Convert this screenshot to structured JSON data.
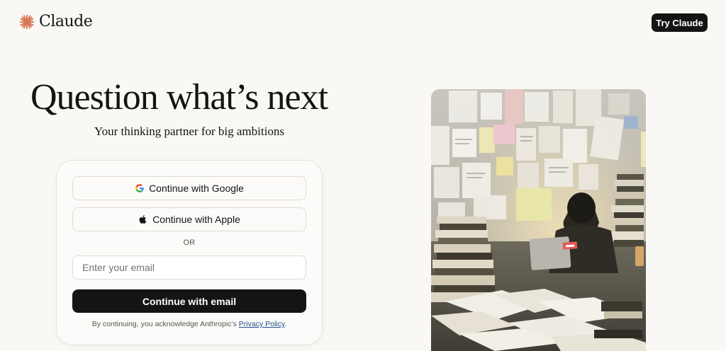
{
  "header": {
    "brand": "Claude",
    "try_button": "Try Claude"
  },
  "hero": {
    "headline": "Question what’s next",
    "subheadline": "Your thinking partner for big ambitions"
  },
  "login_card": {
    "google_button": "Continue with Google",
    "apple_button": "Continue with Apple",
    "divider": "OR",
    "email_placeholder": "Enter your email",
    "continue_button": "Continue with email",
    "disclaimer_prefix": "By continuing, you acknowledge Anthropic’s",
    "privacy_link": "Privacy Policy",
    "disclaimer_suffix": "."
  },
  "colors": {
    "background": "#f9f8f5",
    "brand_accent": "#d97757",
    "primary_button": "#141413",
    "link": "#1f4e8a"
  },
  "icons": [
    "claude-logo-icon",
    "google-icon",
    "apple-icon"
  ]
}
